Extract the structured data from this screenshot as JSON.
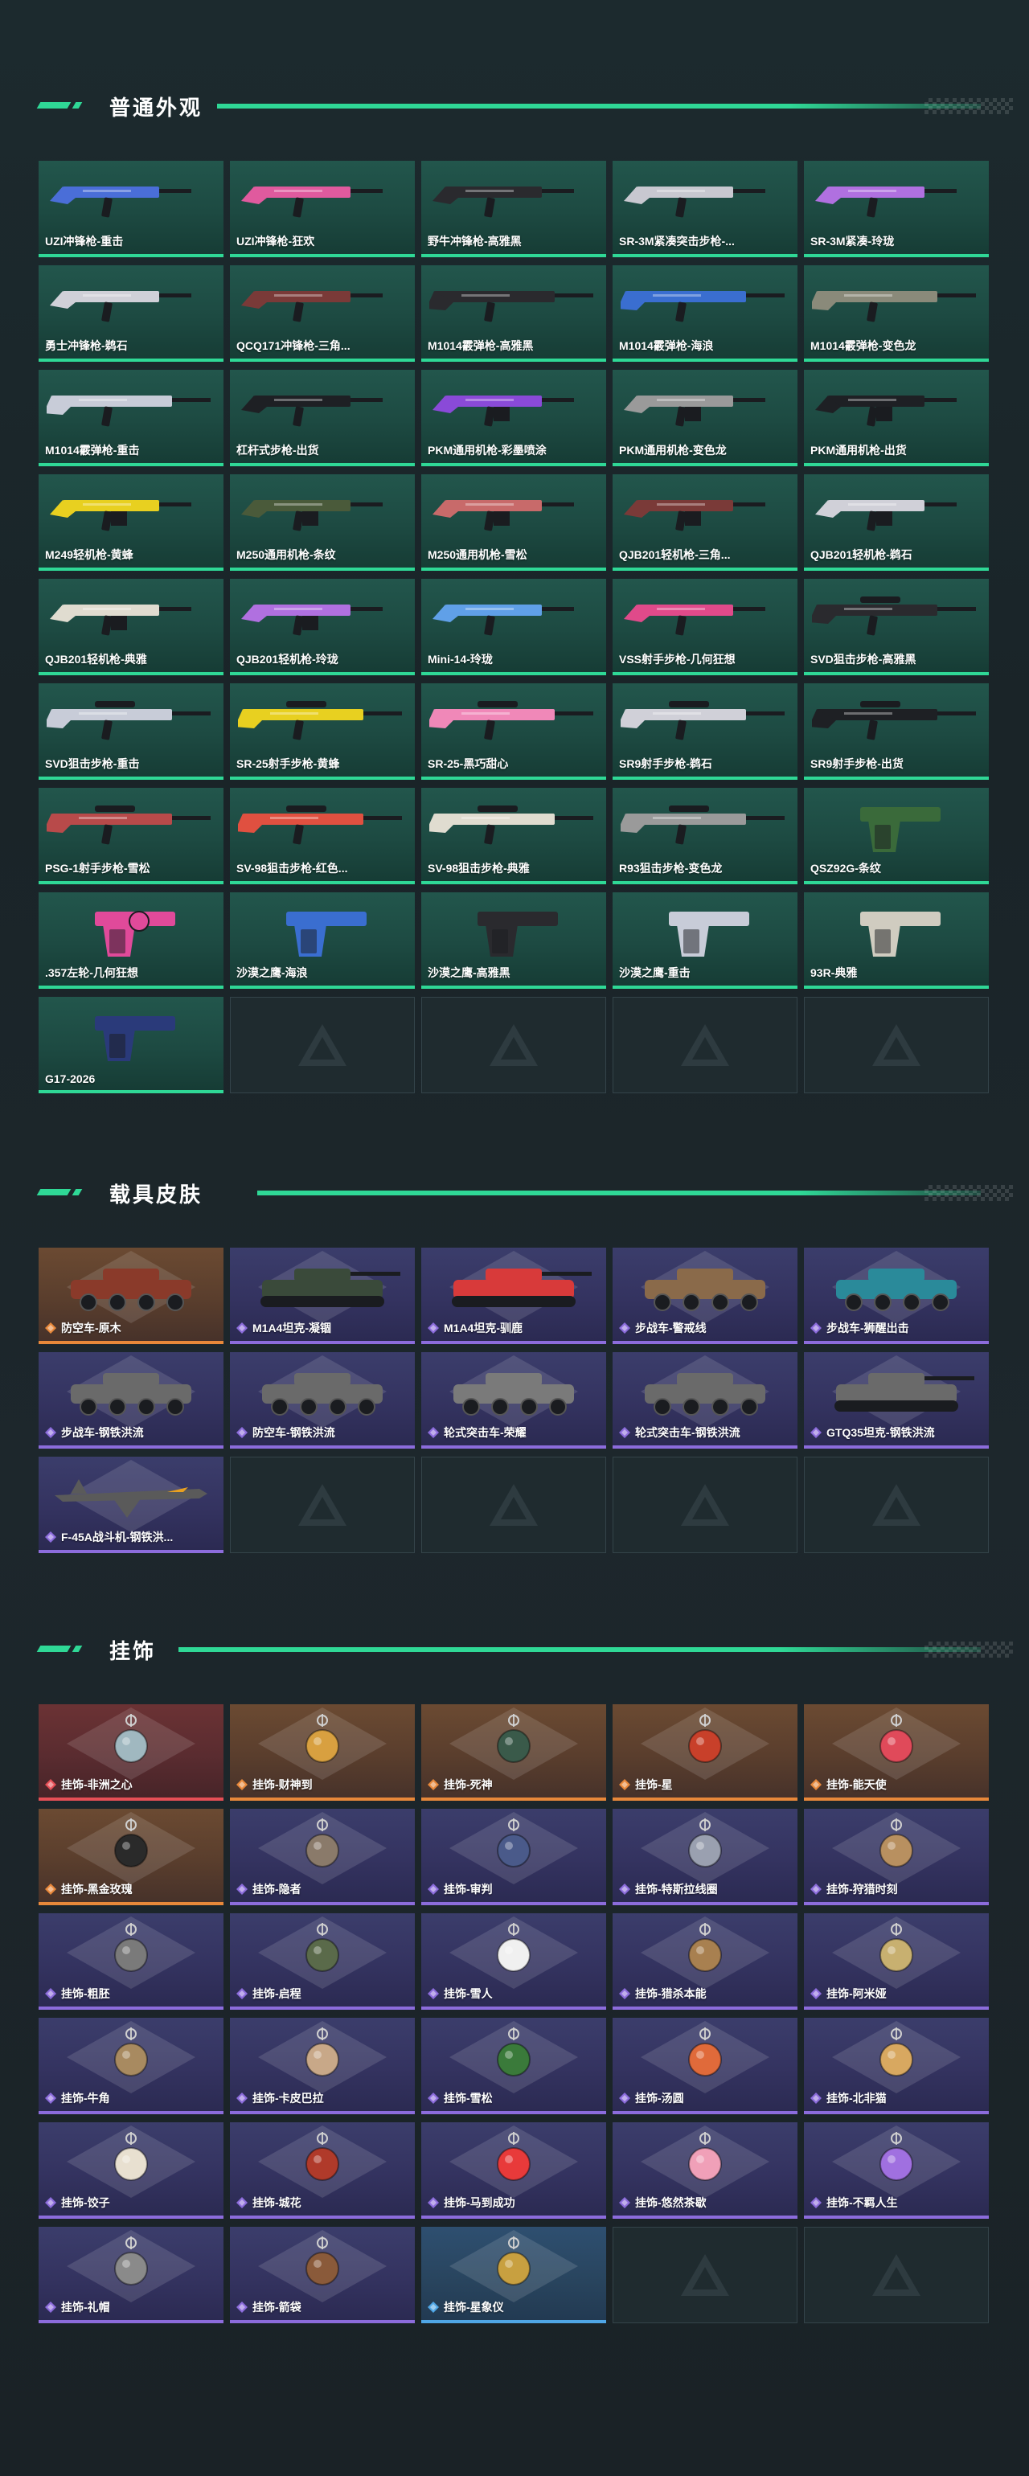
{
  "colors": {
    "accent": "#2fd896",
    "weapon_card": "#1d4a42",
    "purple_rarity": "#8c6cdc",
    "orange_rarity": "#e8883a",
    "red_rarity": "#e64f56",
    "blue_rarity": "#4fa6e6",
    "empty_card": "#1f2b2f"
  },
  "sections": [
    {
      "title": "普通外观",
      "items": [
        {
          "label": "UZI冲锋枪-重击",
          "rarity": "weapon",
          "icon": "smg-icon",
          "color": "#4a6ed8"
        },
        {
          "label": "UZI冲锋枪-狂欢",
          "rarity": "weapon",
          "icon": "smg-icon",
          "color": "#e05a9e"
        },
        {
          "label": "野牛冲锋枪-高雅黑",
          "rarity": "weapon",
          "icon": "smg-icon",
          "color": "#2a2a2e"
        },
        {
          "label": "SR-3M紧凑突击步枪-...",
          "rarity": "weapon",
          "icon": "rifle-icon",
          "color": "#c8c8d0"
        },
        {
          "label": "SR-3M紧凑-玲珑",
          "rarity": "weapon",
          "icon": "rifle-icon",
          "color": "#b070e0"
        },
        {
          "label": "勇士冲锋枪-鹈石",
          "rarity": "weapon",
          "icon": "smg-icon",
          "color": "#d0d0d8"
        },
        {
          "label": "QCQ171冲锋枪-三角...",
          "rarity": "weapon",
          "icon": "smg-icon",
          "color": "#7a3a38"
        },
        {
          "label": "M1014霰弹枪-高雅黑",
          "rarity": "weapon",
          "icon": "shotgun-icon",
          "color": "#2a2a2e"
        },
        {
          "label": "M1014霰弹枪-海浪",
          "rarity": "weapon",
          "icon": "shotgun-icon",
          "color": "#3a6ed0"
        },
        {
          "label": "M1014霰弹枪-变色龙",
          "rarity": "weapon",
          "icon": "shotgun-icon",
          "color": "#8a8a7a"
        },
        {
          "label": "M1014霰弹枪-重击",
          "rarity": "weapon",
          "icon": "shotgun-icon",
          "color": "#c8ccd8"
        },
        {
          "label": "杠杆式步枪-出货",
          "rarity": "weapon",
          "icon": "rifle-icon",
          "color": "#1e2024"
        },
        {
          "label": "PKM通用机枪-彩墨喷涂",
          "rarity": "weapon",
          "icon": "machinegun-icon",
          "color": "#8a4ad8"
        },
        {
          "label": "PKM通用机枪-变色龙",
          "rarity": "weapon",
          "icon": "machinegun-icon",
          "color": "#9a9a9a"
        },
        {
          "label": "PKM通用机枪-出货",
          "rarity": "weapon",
          "icon": "machinegun-icon",
          "color": "#1e2024"
        },
        {
          "label": "M249轻机枪-黄蜂",
          "rarity": "weapon",
          "icon": "machinegun-icon",
          "color": "#e8d020"
        },
        {
          "label": "M250通用机枪-条纹",
          "rarity": "weapon",
          "icon": "machinegun-icon",
          "color": "#4a5a3a"
        },
        {
          "label": "M250通用机枪-雪松",
          "rarity": "weapon",
          "icon": "machinegun-icon",
          "color": "#c86a6a"
        },
        {
          "label": "QJB201轻机枪-三角...",
          "rarity": "weapon",
          "icon": "machinegun-icon",
          "color": "#7a3a38"
        },
        {
          "label": "QJB201轻机枪-鹈石",
          "rarity": "weapon",
          "icon": "machinegun-icon",
          "color": "#d0d0d8"
        },
        {
          "label": "QJB201轻机枪-典雅",
          "rarity": "weapon",
          "icon": "machinegun-icon",
          "color": "#e0dcd0"
        },
        {
          "label": "QJB201轻机枪-玲珑",
          "rarity": "weapon",
          "icon": "machinegun-icon",
          "color": "#b070e0"
        },
        {
          "label": "Mini-14-玲珑",
          "rarity": "weapon",
          "icon": "rifle-icon",
          "color": "#60a0e8"
        },
        {
          "label": "VSS射手步枪-几何狂想",
          "rarity": "weapon",
          "icon": "rifle-icon",
          "color": "#e04a8a"
        },
        {
          "label": "SVD狙击步枪-高雅黑",
          "rarity": "weapon",
          "icon": "sniper-icon",
          "color": "#2a2a2e"
        },
        {
          "label": "SVD狙击步枪-重击",
          "rarity": "weapon",
          "icon": "sniper-icon",
          "color": "#c8ccd8"
        },
        {
          "label": "SR-25射手步枪-黄蜂",
          "rarity": "weapon",
          "icon": "sniper-icon",
          "color": "#e8d020"
        },
        {
          "label": "SR-25-黑巧甜心",
          "rarity": "weapon",
          "icon": "sniper-icon",
          "color": "#f088b8"
        },
        {
          "label": "SR9射手步枪-鹈石",
          "rarity": "weapon",
          "icon": "sniper-icon",
          "color": "#d0d0d8"
        },
        {
          "label": "SR9射手步枪-出货",
          "rarity": "weapon",
          "icon": "sniper-icon",
          "color": "#1e2024"
        },
        {
          "label": "PSG-1射手步枪-雪松",
          "rarity": "weapon",
          "icon": "sniper-icon",
          "color": "#b84a4a"
        },
        {
          "label": "SV-98狙击步枪-红色...",
          "rarity": "weapon",
          "icon": "sniper-icon",
          "color": "#e05040"
        },
        {
          "label": "SV-98狙击步枪-典雅",
          "rarity": "weapon",
          "icon": "sniper-icon",
          "color": "#e0dcd0"
        },
        {
          "label": "R93狙击步枪-变色龙",
          "rarity": "weapon",
          "icon": "sniper-icon",
          "color": "#9a9a9a"
        },
        {
          "label": "QSZ92G-条纹",
          "rarity": "weapon",
          "icon": "pistol-icon",
          "color": "#3a6a3a"
        },
        {
          "label": ".357左轮-几何狂想",
          "rarity": "weapon",
          "icon": "revolver-icon",
          "color": "#e04a9a"
        },
        {
          "label": "沙漠之鹰-海浪",
          "rarity": "weapon",
          "icon": "pistol-icon",
          "color": "#3a6ed0"
        },
        {
          "label": "沙漠之鹰-高雅黑",
          "rarity": "weapon",
          "icon": "pistol-icon",
          "color": "#2a2a2e"
        },
        {
          "label": "沙漠之鹰-重击",
          "rarity": "weapon",
          "icon": "pistol-icon",
          "color": "#c8ccd8"
        },
        {
          "label": "93R-典雅",
          "rarity": "weapon",
          "icon": "pistol-icon",
          "color": "#d0ccc0"
        },
        {
          "label": "G17-2026",
          "rarity": "weapon",
          "icon": "pistol-icon",
          "color": "#2a3a7a"
        },
        {
          "empty": true
        },
        {
          "empty": true
        },
        {
          "empty": true
        },
        {
          "empty": true
        }
      ]
    },
    {
      "title": "载具皮肤",
      "items": [
        {
          "label": "防空车-原木",
          "rarity": "orange",
          "icon": "apc-icon",
          "color": "#8a3a2a"
        },
        {
          "label": "M1A4坦克-凝锢",
          "rarity": "purple",
          "icon": "tank-icon",
          "color": "#3a4a3a"
        },
        {
          "label": "M1A4坦克-驯鹿",
          "rarity": "purple",
          "icon": "tank-icon",
          "color": "#d83a3a"
        },
        {
          "label": "步战车-警戒线",
          "rarity": "purple",
          "icon": "apc-icon",
          "color": "#8a6a4a"
        },
        {
          "label": "步战车-狮醒出击",
          "rarity": "purple",
          "icon": "apc-icon",
          "color": "#2a8a9a"
        },
        {
          "label": "步战车-钢铁洪流",
          "rarity": "purple",
          "icon": "apc-icon",
          "color": "#6a6a6a"
        },
        {
          "label": "防空车-钢铁洪流",
          "rarity": "purple",
          "icon": "apc-icon",
          "color": "#6a6a6a"
        },
        {
          "label": "轮式突击车-荣耀",
          "rarity": "purple",
          "icon": "buggy-icon",
          "color": "#7a7a7a"
        },
        {
          "label": "轮式突击车-钢铁洪流",
          "rarity": "purple",
          "icon": "buggy-icon",
          "color": "#6a6a6a"
        },
        {
          "label": "GTQ35坦克-钢铁洪流",
          "rarity": "purple",
          "icon": "tank-icon",
          "color": "#6a6a6a"
        },
        {
          "label": "F-45A战斗机-钢铁洪...",
          "rarity": "purple",
          "icon": "jet-icon",
          "color": "#5a5a5a"
        },
        {
          "empty": true
        },
        {
          "empty": true
        },
        {
          "empty": true
        },
        {
          "empty": true
        }
      ]
    },
    {
      "title": "挂饰",
      "items": [
        {
          "label": "挂饰-非洲之心",
          "rarity": "red",
          "icon": "charm-icon",
          "color": "#a0b8c0"
        },
        {
          "label": "挂饰-财神到",
          "rarity": "orange",
          "icon": "charm-icon",
          "color": "#d8a040"
        },
        {
          "label": "挂饰-死神",
          "rarity": "orange",
          "icon": "charm-icon",
          "color": "#3a5a4a"
        },
        {
          "label": "挂饰-星",
          "rarity": "orange",
          "icon": "charm-icon",
          "color": "#c8402a"
        },
        {
          "label": "挂饰-能天使",
          "rarity": "orange",
          "icon": "charm-icon",
          "color": "#e04a5a"
        },
        {
          "label": "挂饰-黑金玫瑰",
          "rarity": "orange",
          "icon": "charm-icon",
          "color": "#2a2a2a"
        },
        {
          "label": "挂饰-隐者",
          "rarity": "purple",
          "icon": "charm-icon",
          "color": "#8a7a6a"
        },
        {
          "label": "挂饰-审判",
          "rarity": "purple",
          "icon": "charm-icon",
          "color": "#4a5a8a"
        },
        {
          "label": "挂饰-特斯拉线圈",
          "rarity": "purple",
          "icon": "charm-icon",
          "color": "#9aa0b0"
        },
        {
          "label": "挂饰-狩猎时刻",
          "rarity": "purple",
          "icon": "charm-icon",
          "color": "#b89060"
        },
        {
          "label": "挂饰-粗胚",
          "rarity": "purple",
          "icon": "charm-icon",
          "color": "#7a7a7a"
        },
        {
          "label": "挂饰-启程",
          "rarity": "purple",
          "icon": "charm-icon",
          "color": "#5a6a4a"
        },
        {
          "label": "挂饰-雪人",
          "rarity": "purple",
          "icon": "charm-icon",
          "color": "#f0f0f0"
        },
        {
          "label": "挂饰-猎杀本能",
          "rarity": "purple",
          "icon": "charm-icon",
          "color": "#a88050"
        },
        {
          "label": "挂饰-阿米娅",
          "rarity": "purple",
          "icon": "charm-icon",
          "color": "#c8b070"
        },
        {
          "label": "挂饰-牛角",
          "rarity": "purple",
          "icon": "charm-icon",
          "color": "#a88a60"
        },
        {
          "label": "挂饰-卡皮巴拉",
          "rarity": "purple",
          "icon": "charm-icon",
          "color": "#c8a888"
        },
        {
          "label": "挂饰-雪松",
          "rarity": "purple",
          "icon": "charm-icon",
          "color": "#3a7a3a"
        },
        {
          "label": "挂饰-汤圆",
          "rarity": "purple",
          "icon": "charm-icon",
          "color": "#e06a3a"
        },
        {
          "label": "挂饰-北非猫",
          "rarity": "purple",
          "icon": "charm-icon",
          "color": "#d8a860"
        },
        {
          "label": "挂饰-饺子",
          "rarity": "purple",
          "icon": "charm-icon",
          "color": "#e8e0d0"
        },
        {
          "label": "挂饰-城花",
          "rarity": "purple",
          "icon": "charm-icon",
          "color": "#b03a2a"
        },
        {
          "label": "挂饰-马到成功",
          "rarity": "purple",
          "icon": "charm-icon",
          "color": "#e83a3a"
        },
        {
          "label": "挂饰-悠然茶歇",
          "rarity": "purple",
          "icon": "charm-icon",
          "color": "#f0a0b8"
        },
        {
          "label": "挂饰-不羁人生",
          "rarity": "purple",
          "icon": "charm-icon",
          "color": "#a070e0"
        },
        {
          "label": "挂饰-礼帽",
          "rarity": "purple",
          "icon": "charm-icon",
          "color": "#8a8a8a"
        },
        {
          "label": "挂饰-箭袋",
          "rarity": "purple",
          "icon": "charm-icon",
          "color": "#8a5a3a"
        },
        {
          "label": "挂饰-星象仪",
          "rarity": "blue",
          "icon": "charm-icon",
          "color": "#c8a040"
        },
        {
          "empty": true
        },
        {
          "empty": true
        }
      ]
    }
  ]
}
